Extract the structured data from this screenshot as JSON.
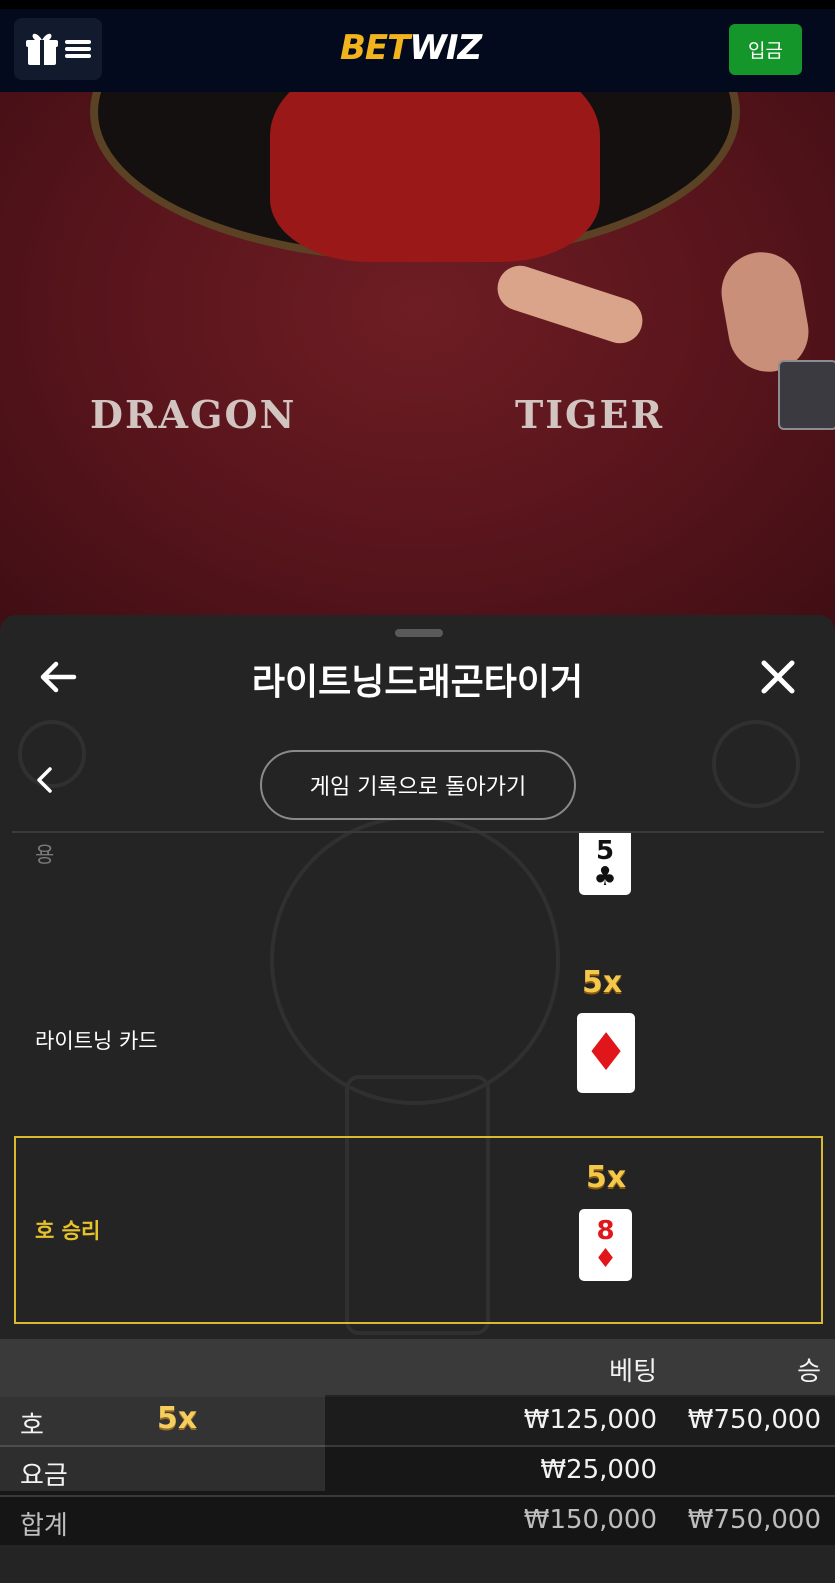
{
  "header": {
    "logo_part1": "BET",
    "logo_part2": "WIZ",
    "deposit_label": "입금"
  },
  "video": {
    "left_label": "DRAGON",
    "right_label": "TIGER"
  },
  "sheet": {
    "title": "라이트닝드래곤타이거",
    "back_to_history": "게임 기록으로 돌아가기",
    "rows": [
      {
        "label": "용",
        "card_rank": "5",
        "card_suit": "♣",
        "card_color": "#111111"
      },
      {
        "label": "라이트닝 카드",
        "multiplier": "5x",
        "card_rank": "",
        "card_suit": "♦",
        "card_color": "#e0161a"
      },
      {
        "label": "호 승리",
        "multiplier": "5x",
        "card_rank": "8",
        "card_suit": "♦",
        "card_color": "#e0161a",
        "label_color": "#e8c22a"
      }
    ],
    "table": {
      "headers": [
        "베팅",
        "승"
      ],
      "rows": [
        {
          "name": "호",
          "multiplier": "5x",
          "bet": "₩125,000",
          "win": "₩750,000"
        },
        {
          "name": "요금",
          "bet": "₩25,000",
          "win": ""
        },
        {
          "name": "합계",
          "bet": "₩150,000",
          "win": "₩750,000"
        }
      ]
    }
  },
  "colors": {
    "accent_gold": "#f2b41c",
    "deposit_green": "#14962b",
    "highlight_border": "#d9b92f"
  }
}
